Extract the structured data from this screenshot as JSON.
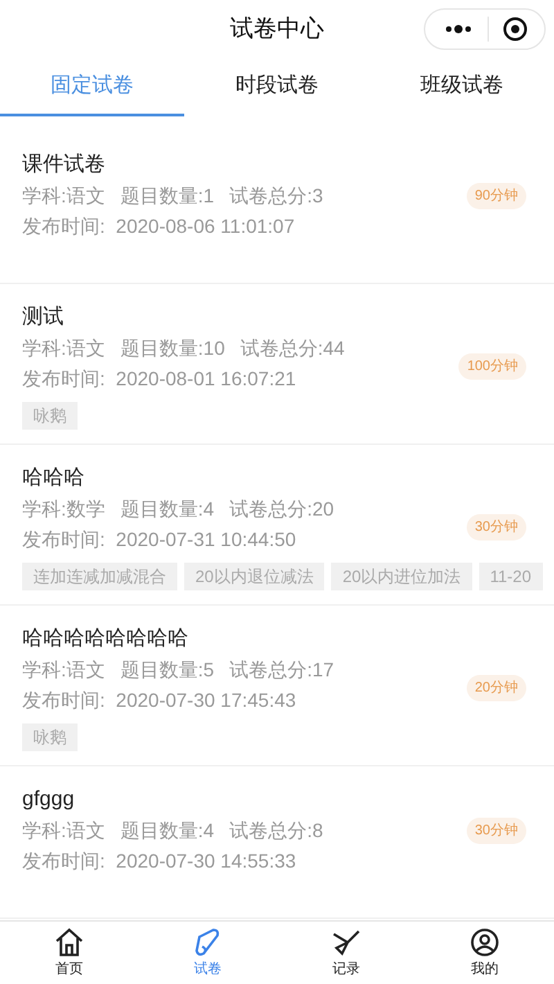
{
  "header": {
    "title": "试卷中心"
  },
  "tabs": [
    {
      "label": "固定试卷",
      "selected": true
    },
    {
      "label": "时段试卷",
      "selected": false
    },
    {
      "label": "班级试卷",
      "selected": false
    }
  ],
  "papers": [
    {
      "title": "课件试卷",
      "subject": "学科:语文",
      "count": "题目数量:1",
      "total": "试卷总分:3",
      "time": "发布时间:  2020-08-06 11:01:07",
      "duration": "90分钟"
    },
    {
      "title": "测试",
      "subject": "学科:语文",
      "count": "题目数量:10",
      "total": "试卷总分:44",
      "time": "发布时间:  2020-08-01 16:07:21",
      "duration": "100分钟",
      "tags": [
        "咏鹅"
      ]
    },
    {
      "title": "哈哈哈",
      "subject": "学科:数学",
      "count": "题目数量:4",
      "total": "试卷总分:20",
      "time": "发布时间:  2020-07-31 10:44:50",
      "duration": "30分钟",
      "tags": [
        "连加连减加减混合",
        "20以内退位减法",
        "20以内进位加法",
        "11-20"
      ]
    },
    {
      "title": "哈哈哈哈哈哈哈哈",
      "subject": "学科:语文",
      "count": "题目数量:5",
      "total": "试卷总分:17",
      "time": "发布时间:  2020-07-30 17:45:43",
      "duration": "20分钟",
      "tags": [
        "咏鹅"
      ]
    },
    {
      "title": "gfggg",
      "subject": "学科:语文",
      "count": "题目数量:4",
      "total": "试卷总分:8",
      "time": "发布时间:  2020-07-30 14:55:33",
      "duration": "30分钟"
    }
  ],
  "nav": [
    {
      "label": "首页",
      "selected": false
    },
    {
      "label": "试卷",
      "selected": true
    },
    {
      "label": "记录",
      "selected": false
    },
    {
      "label": "我的",
      "selected": false
    }
  ]
}
